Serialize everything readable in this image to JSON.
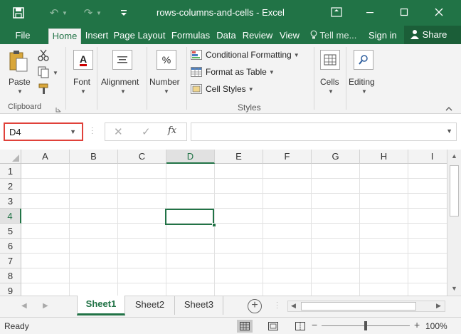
{
  "window": {
    "title": "rows-columns-and-cells - Excel",
    "qat": [
      "save-icon",
      "undo-icon",
      "redo-icon",
      "customize-qat-icon"
    ],
    "controls": [
      "ribbon-display-icon",
      "minimize-icon",
      "maximize-icon",
      "close-icon"
    ]
  },
  "tabs": [
    {
      "label": "File"
    },
    {
      "label": "Home",
      "active": true
    },
    {
      "label": "Insert"
    },
    {
      "label": "Page Layout"
    },
    {
      "label": "Formulas"
    },
    {
      "label": "Data"
    },
    {
      "label": "Review"
    },
    {
      "label": "View"
    }
  ],
  "tell_me": "Tell me...",
  "sign_in": "Sign in",
  "share": "Share",
  "ribbon": {
    "clipboard": {
      "paste": "Paste",
      "group_label": "Clipboard"
    },
    "font": {
      "label": "Font",
      "icon_text": "A"
    },
    "alignment": {
      "label": "Alignment"
    },
    "number": {
      "label": "Number",
      "icon_text": "%"
    },
    "styles": {
      "conditional_formatting": "Conditional Formatting",
      "format_as_table": "Format as Table",
      "cell_styles": "Cell Styles",
      "group_label": "Styles"
    },
    "cells": {
      "label": "Cells"
    },
    "editing": {
      "label": "Editing"
    }
  },
  "formula_bar": {
    "name_box": "D4",
    "cancel": "✕",
    "enter": "✓",
    "fx": "fx",
    "formula": ""
  },
  "grid": {
    "columns": [
      "A",
      "B",
      "C",
      "D",
      "E",
      "F",
      "G",
      "H",
      "I"
    ],
    "rows": [
      "1",
      "2",
      "3",
      "4",
      "5",
      "6",
      "7",
      "8",
      "9"
    ],
    "active_cell": "D4",
    "active_column": "D",
    "active_row": "4"
  },
  "sheets": [
    {
      "label": "Sheet1",
      "active": true
    },
    {
      "label": "Sheet2"
    },
    {
      "label": "Sheet3"
    }
  ],
  "add_sheet": "+",
  "status": {
    "text": "Ready",
    "zoom": "100%",
    "zoom_minus": "−",
    "zoom_plus": "+"
  }
}
